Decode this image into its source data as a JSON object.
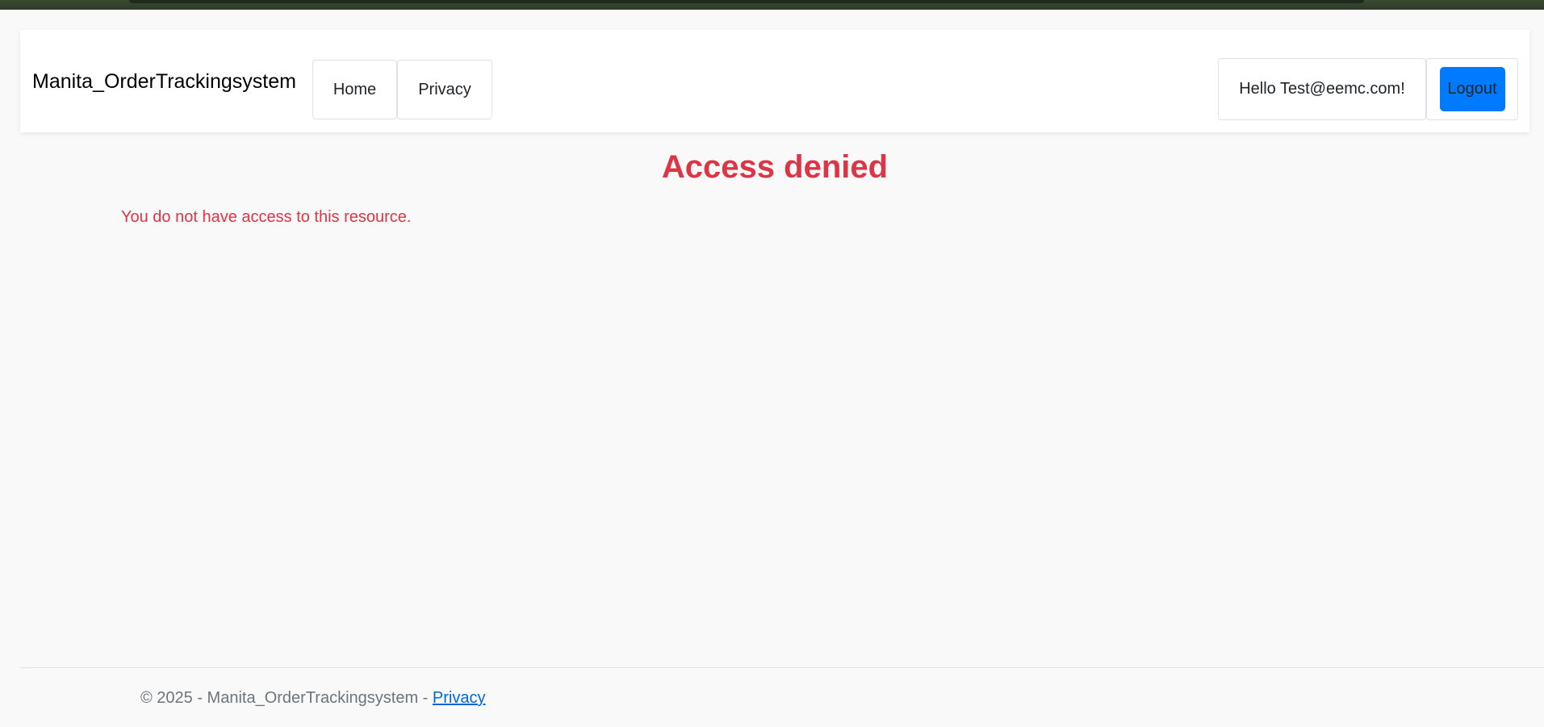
{
  "navbar": {
    "brand": "Manita_OrderTrackingsystem",
    "items": [
      {
        "label": "Home"
      },
      {
        "label": "Privacy"
      }
    ],
    "greeting": "Hello Test@eemc.com!",
    "logout_label": "Logout"
  },
  "main": {
    "title": "Access denied",
    "message": "You do not have access to this resource."
  },
  "footer": {
    "text": "© 2025 - Manita_OrderTrackingsystem - ",
    "privacy_link": "Privacy"
  },
  "colors": {
    "accent": "#007bff",
    "error": "#dc3545",
    "muted": "#6c757d",
    "link": "#0366d6"
  }
}
